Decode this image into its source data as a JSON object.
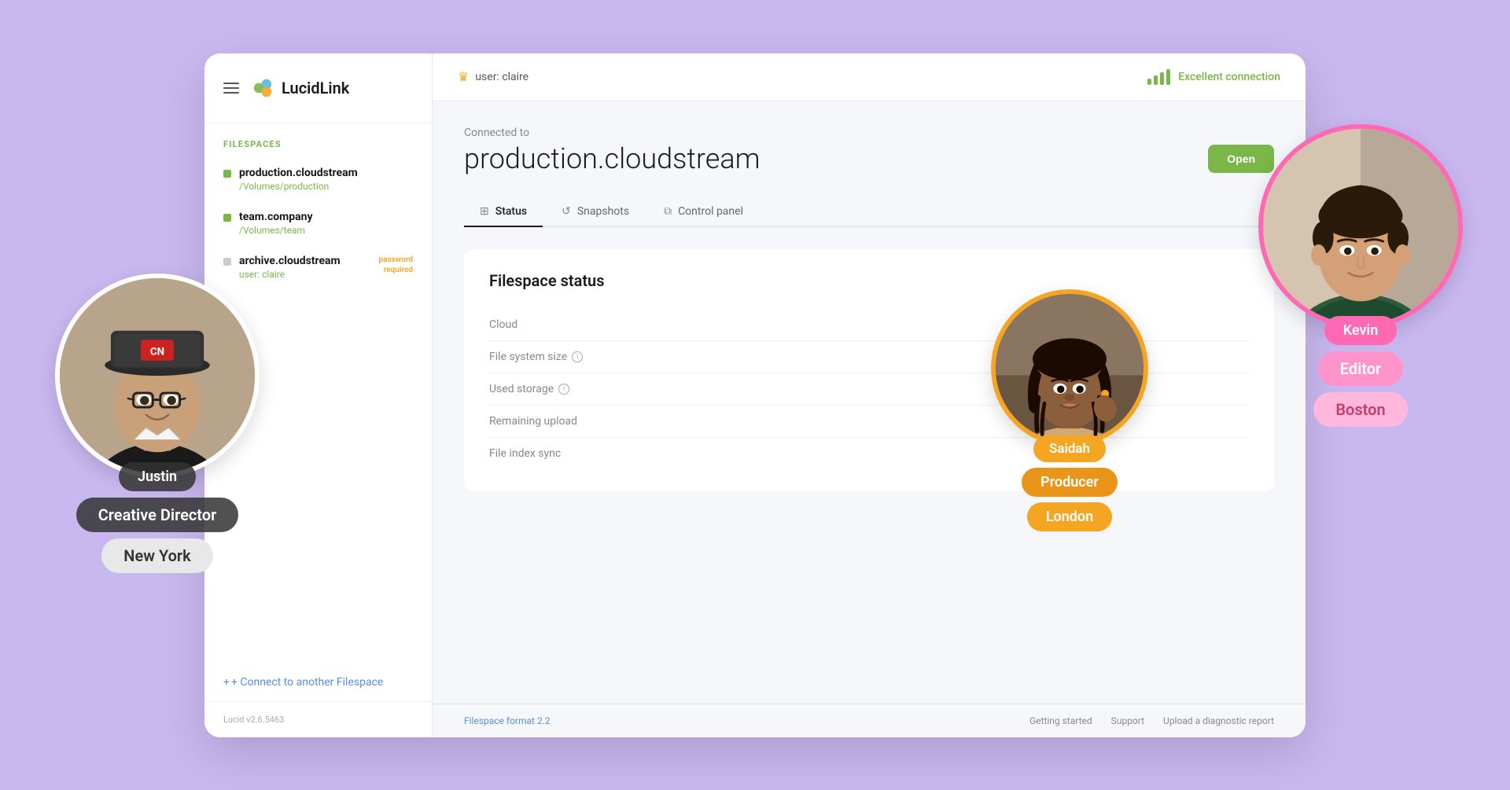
{
  "app": {
    "title": "LucidLink",
    "version": "Lucid v2.6.5463"
  },
  "header": {
    "hamburger_label": "menu",
    "user_label": "user: claire",
    "connection_status": "Excellent connection",
    "connection_quality": "excellent"
  },
  "sidebar": {
    "section_label": "FILESPACES",
    "filespaces": [
      {
        "name": "production.cloudstream",
        "path": "/Volumes/production",
        "active": true,
        "password_required": false
      },
      {
        "name": "team.company",
        "path": "/Volumes/team",
        "active": true,
        "password_required": false
      },
      {
        "name": "archive.cloudstream",
        "path": "user: claire",
        "active": false,
        "password_required": true,
        "password_label": "password\nrequired"
      }
    ],
    "connect_label": "+ Connect to another Filespace"
  },
  "main": {
    "connected_to_label": "Connected to",
    "filespace_name": "production.cloudstream",
    "open_button": "Open",
    "tabs": [
      {
        "id": "status",
        "label": "Status",
        "icon": "grid",
        "active": true
      },
      {
        "id": "snapshots",
        "label": "Snapshots",
        "icon": "clock",
        "active": false
      },
      {
        "id": "control_panel",
        "label": "Control panel",
        "icon": "sliders",
        "active": false
      }
    ],
    "status": {
      "title": "Filespace status",
      "rows": [
        {
          "key": "Cloud",
          "value": "",
          "has_info": false
        },
        {
          "key": "File system size",
          "value": "",
          "has_info": true
        },
        {
          "key": "Used storage",
          "value": "",
          "has_info": true
        },
        {
          "key": "Remaining upload",
          "value": "",
          "has_info": false
        },
        {
          "key": "File index sync",
          "value": "",
          "has_info": false
        }
      ]
    },
    "footer": {
      "format_label": "Filespace format 2.2",
      "links": [
        "Getting started",
        "Support",
        "Upload a diagnostic report"
      ]
    }
  },
  "people": {
    "justin": {
      "name": "Justin",
      "role": "Creative Director",
      "location": "New York"
    },
    "kevin": {
      "name": "Kevin",
      "role": "Editor",
      "location": "Boston"
    },
    "saidah": {
      "name": "Saidah",
      "role": "Producer",
      "location": "London"
    }
  },
  "colors": {
    "green": "#7ab648",
    "orange": "#f4a623",
    "pink": "#ff69b4",
    "blue": "#5b8dd9",
    "dark_badge": "rgba(50,50,50,0.85)"
  }
}
